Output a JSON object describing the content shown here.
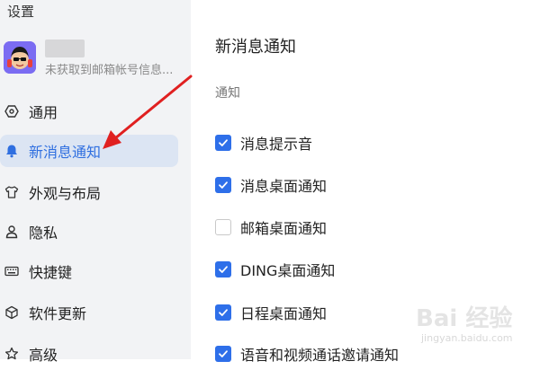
{
  "sidebar": {
    "title": "设置",
    "account": {
      "subtitle": "未获取到邮箱帐号信息..."
    },
    "items": [
      {
        "label": "通用",
        "icon": "hexagon-icon"
      },
      {
        "label": "新消息通知",
        "icon": "bell-icon"
      },
      {
        "label": "外观与布局",
        "icon": "shirt-icon"
      },
      {
        "label": "隐私",
        "icon": "person-icon"
      },
      {
        "label": "快捷键",
        "icon": "keyboard-icon"
      },
      {
        "label": "软件更新",
        "icon": "cube-icon"
      },
      {
        "label": "高级",
        "icon": "star-icon"
      }
    ]
  },
  "main": {
    "title": "新消息通知",
    "section": "通知",
    "options": [
      {
        "label": "消息提示音",
        "checked": true
      },
      {
        "label": "消息桌面通知",
        "checked": true
      },
      {
        "label": "邮箱桌面通知",
        "checked": false
      },
      {
        "label": "DING桌面通知",
        "checked": true
      },
      {
        "label": "日程桌面通知",
        "checked": true
      },
      {
        "label": "语音和视频通话邀请通知",
        "checked": true
      }
    ]
  },
  "watermark": {
    "brand": "Bai 经验",
    "url": "jingyan.baidu.com"
  },
  "colors": {
    "accent": "#2e6fe9",
    "arrow": "#e02020",
    "sidebar_bg": "#f2f3f5",
    "active_bg": "#dce5f3"
  }
}
